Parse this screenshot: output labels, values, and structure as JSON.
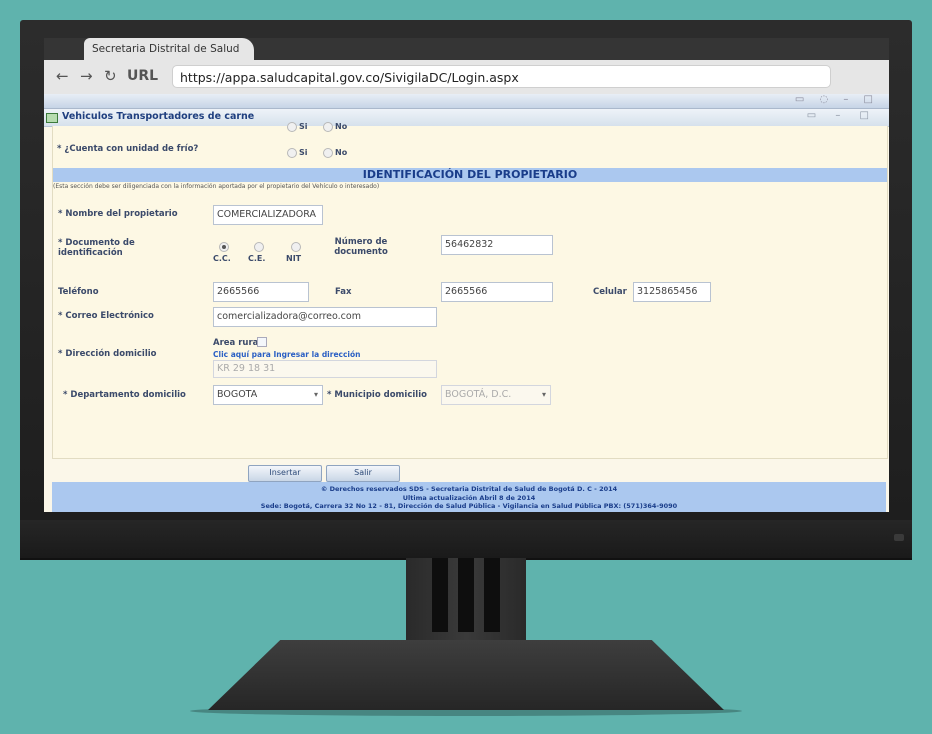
{
  "browser": {
    "tab_title": "Secretaria Distrital de Salud",
    "back_icon": "←",
    "forward_icon": "→",
    "reload_icon": "↻",
    "url_label": "URL",
    "url": "https://appa.saludcapital.gov.co/SivigilaDC/Login.aspx"
  },
  "window": {
    "title": "Vehiculos Transportadores de carne"
  },
  "form": {
    "prev_question_answers": {
      "si": "Si",
      "no": "No"
    },
    "cold_unit": {
      "label": "* ¿Cuenta con unidad de frío?",
      "si": "Si",
      "no": "No"
    },
    "section_title": "IDENTIFICACIÓN DEL PROPIETARIO",
    "section_note": "(Esta sección debe ser diligenciada con la información aportada por el propietario del Vehículo o interesado)",
    "owner_name": {
      "label": "* Nombre del propietario",
      "value": "COMERCIALIZADORA"
    },
    "doc_type": {
      "label": "* Documento de identificación",
      "options": [
        "C.C.",
        "C.E.",
        "NIT"
      ],
      "selected": "C.C."
    },
    "doc_number": {
      "label": "Número de documento",
      "value": "56462832"
    },
    "phone": {
      "label": "Teléfono",
      "value": "2665566"
    },
    "fax": {
      "label": "Fax",
      "value": "2665566"
    },
    "mobile": {
      "label": "Celular",
      "value": "3125865456"
    },
    "email": {
      "label": "* Correo Electrónico",
      "value": "comercializadora@correo.com"
    },
    "address": {
      "label": "* Dirección domicilio",
      "rural_label": "Area rural",
      "link": "Clic aquí para Ingresar la dirección",
      "value": "KR 29 18 31"
    },
    "department": {
      "label": "* Departamento domicilio",
      "value": "BOGOTA"
    },
    "municipality": {
      "label": "* Municipio domicilio",
      "value": "BOGOTÁ, D.C."
    }
  },
  "buttons": {
    "insert": "Insertar",
    "exit": "Salir"
  },
  "footer": {
    "line1": "© Derechos reservados SDS - Secretaria Distrital de Salud de Bogotá D. C - 2014",
    "line2": "Ultima actualización Abril 8 de 2014",
    "line3": "Sede: Bogotá, Carrera 32 No 12 - 81, Dirección de Salud Pública - Vigilancia en Salud Pública PBX: (571)364-9090"
  }
}
